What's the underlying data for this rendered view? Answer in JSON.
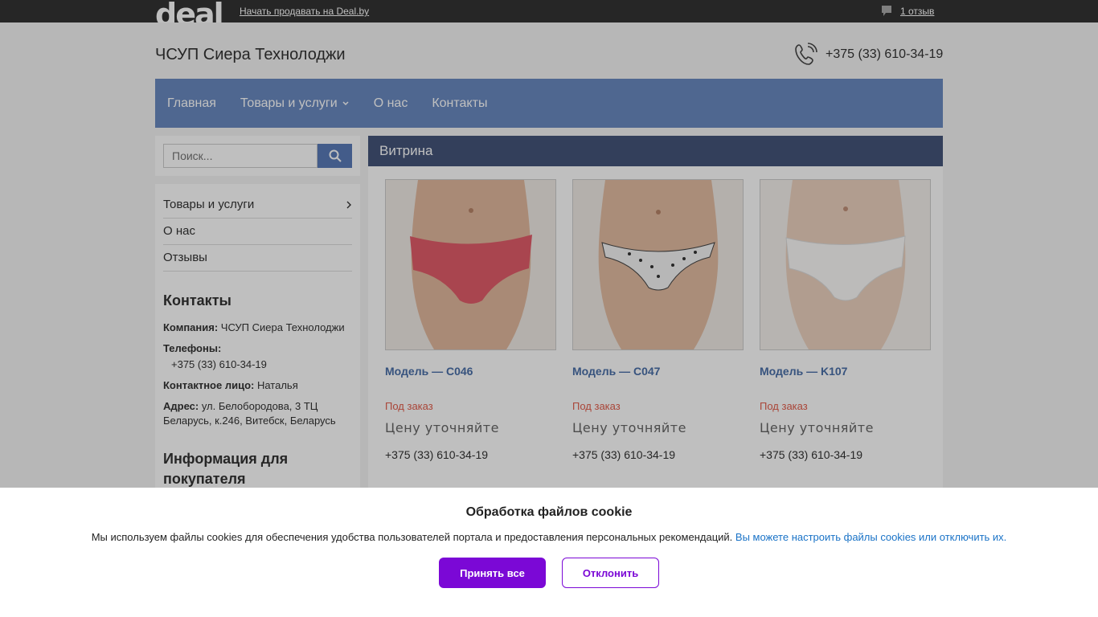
{
  "topbar": {
    "logo": "deal",
    "sell_link": "Начать продавать на Deal.by",
    "reviews": "1 отзыв"
  },
  "header": {
    "company": "ЧСУП Сиера Технолоджи",
    "phone": "+375 (33) 610-34-19"
  },
  "nav": {
    "items": [
      "Главная",
      "Товары и услуги",
      "О нас",
      "Контакты"
    ]
  },
  "sidebar": {
    "search_placeholder": "Поиск...",
    "menu": [
      "Товары и услуги",
      "О нас",
      "Отзывы"
    ],
    "contacts_title": "Контакты",
    "company_label": "Компания:",
    "company_value": "ЧСУП Сиера Технолоджи",
    "phones_label": "Телефоны:",
    "phones_value": "+375 (33) 610-34-19",
    "contact_label": "Контактное лицо:",
    "contact_value": "Наталья",
    "address_label": "Адрес:",
    "address_value": "ул. Белобородова, 3 ТЦ Беларусь, к.246, Витебск, Беларусь",
    "info_title": "Информация для покупателя"
  },
  "main": {
    "title": "Витрина",
    "products": [
      {
        "title": "Модель — C046",
        "status": "Под заказ",
        "price": "Цену уточняйте",
        "phone": "+375 (33) 610-34-19"
      },
      {
        "title": "Модель — C047",
        "status": "Под заказ",
        "price": "Цену уточняйте",
        "phone": "+375 (33) 610-34-19"
      },
      {
        "title": "Модель — K107",
        "status": "Под заказ",
        "price": "Цену уточняйте",
        "phone": "+375 (33) 610-34-19"
      }
    ]
  },
  "cookie": {
    "title": "Обработка файлов cookie",
    "text": "Мы используем файлы cookies для обеспечения удобства пользователей портала и предоставления персональных рекомендаций.",
    "link": "Вы можете настроить файлы cookies или отключить их.",
    "accept": "Принять все",
    "decline": "Отклонить"
  },
  "colors": {
    "nav": "#6a8ac0",
    "accent": "#7b08d6",
    "status": "#e25d4b"
  }
}
